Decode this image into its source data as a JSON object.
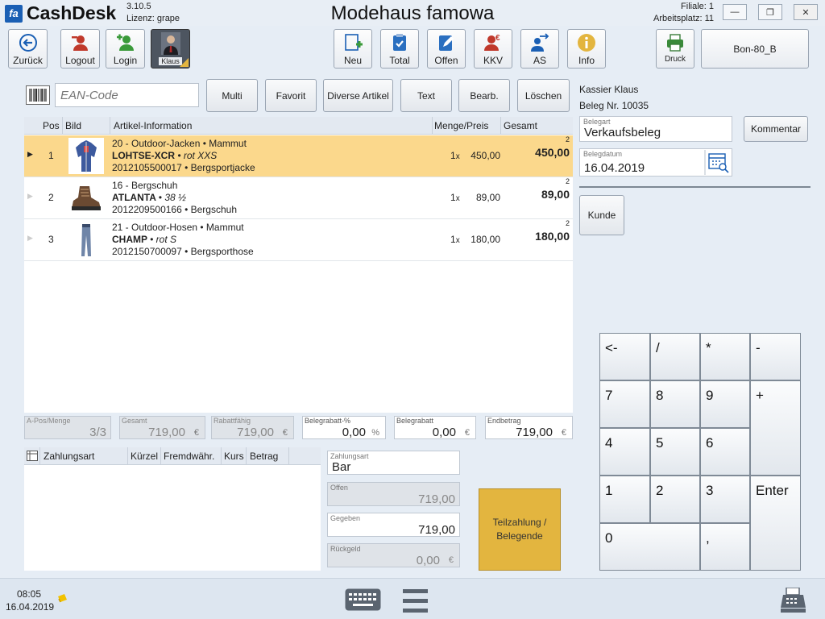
{
  "titlebar": {
    "app_name": "CashDesk",
    "logo_text": "fa",
    "version": "3.10.5",
    "license": "Lizenz: grape",
    "store_name": "Modehaus famowa",
    "filiale": "Filiale: 1",
    "arbeitsplatz": "Arbeitsplatz: 11"
  },
  "toolbar": {
    "back": "Zurück",
    "logout": "Logout",
    "login": "Login",
    "user": "Klaus",
    "neu": "Neu",
    "total": "Total",
    "offen": "Offen",
    "kkv": "KKV",
    "as": "AS",
    "info": "Info",
    "druck": "Druck",
    "printer_name": "Bon-80_B"
  },
  "search": {
    "ean_placeholder": "EAN-Code",
    "buttons": [
      "Multi",
      "Favorit",
      "Diverse Artikel",
      "Text",
      "Bearb.",
      "Löschen"
    ]
  },
  "article_table": {
    "headers": {
      "pos": "Pos",
      "bild": "Bild",
      "info": "Artikel-Information",
      "menge": "Menge/Preis",
      "gesamt": "Gesamt"
    },
    "rows": [
      {
        "pos": "1",
        "line1": "20 - Outdoor-Jacken • Mammut",
        "name": "LOHTSE-XCR",
        "variant": "• rot XXS",
        "line3": "2012105500017 • Bergsportjacke",
        "qty": "1",
        "qty_unit": "x",
        "price": "450,00",
        "badge": "2",
        "total": "450,00",
        "image_icon": "jacket-icon"
      },
      {
        "pos": "2",
        "line1": "16 - Bergschuh",
        "name": "ATLANTA",
        "variant": "• 38 ½",
        "line3": "2012209500166 • Bergschuh",
        "qty": "1",
        "qty_unit": "x",
        "price": "89,00",
        "badge": "2",
        "total": "89,00",
        "image_icon": "boot-icon"
      },
      {
        "pos": "3",
        "line1": "21 - Outdoor-Hosen • Mammut",
        "name": "CHAMP",
        "variant": "• rot S",
        "line3": "2012150700097 • Bergsporthose",
        "qty": "1",
        "qty_unit": "x",
        "price": "180,00",
        "badge": "2",
        "total": "180,00",
        "image_icon": "pants-icon"
      }
    ]
  },
  "summary": {
    "apos": {
      "caption": "A-Pos/Menge",
      "value": "3/3"
    },
    "gesamt": {
      "caption": "Gesamt",
      "value": "719,00",
      "unit": "€"
    },
    "rabattfaehig": {
      "caption": "Rabattfähig",
      "value": "719,00",
      "unit": "€"
    },
    "belegrabatt_pct": {
      "caption": "Belegrabatt-%",
      "value": "0,00",
      "unit": "%"
    },
    "belegrabatt": {
      "caption": "Belegrabatt",
      "value": "0,00",
      "unit": "€"
    },
    "endbetrag": {
      "caption": "Endbetrag",
      "value": "719,00",
      "unit": "€"
    }
  },
  "payment": {
    "headers": {
      "zahlungsart": "Zahlungsart",
      "kuerzel": "Kürzel",
      "fremd": "Fremdwähr.",
      "kurs": "Kurs",
      "betrag": "Betrag"
    },
    "zahlungsart": {
      "caption": "Zahlungsart",
      "value": "Bar"
    },
    "offen": {
      "caption": "Offen",
      "value": "719,00"
    },
    "gegeben": {
      "caption": "Gegeben",
      "value": "719,00"
    },
    "rueckgeld": {
      "caption": "Rückgeld",
      "value": "0,00",
      "unit": "€"
    },
    "teilzahlung_line1": "Teilzahlung /",
    "teilzahlung_line2": "Belegende"
  },
  "right_panel": {
    "cashier": "Kassier Klaus",
    "beleg": "Beleg Nr. 10035",
    "belegart": {
      "caption": "Belegart",
      "value": "Verkaufsbeleg"
    },
    "kommentar": "Kommentar",
    "belegdatum": {
      "caption": "Belegdatum",
      "value": "16.04.2019"
    },
    "kunde": "Kunde"
  },
  "numpad": {
    "keys": [
      "<-",
      "/",
      "*",
      "-",
      "7",
      "8",
      "9",
      "+",
      "4",
      "5",
      "6",
      "1",
      "2",
      "3",
      "Enter",
      "0",
      ","
    ]
  },
  "statusbar": {
    "time": "08:05",
    "date": "16.04.2019"
  },
  "colors": {
    "selected_row": "#fbd88c",
    "teilzahlung": "#e3b53f",
    "accent_blue": "#1a5fb4",
    "logout_red": "#c0392b",
    "login_green": "#3a9a3a"
  }
}
